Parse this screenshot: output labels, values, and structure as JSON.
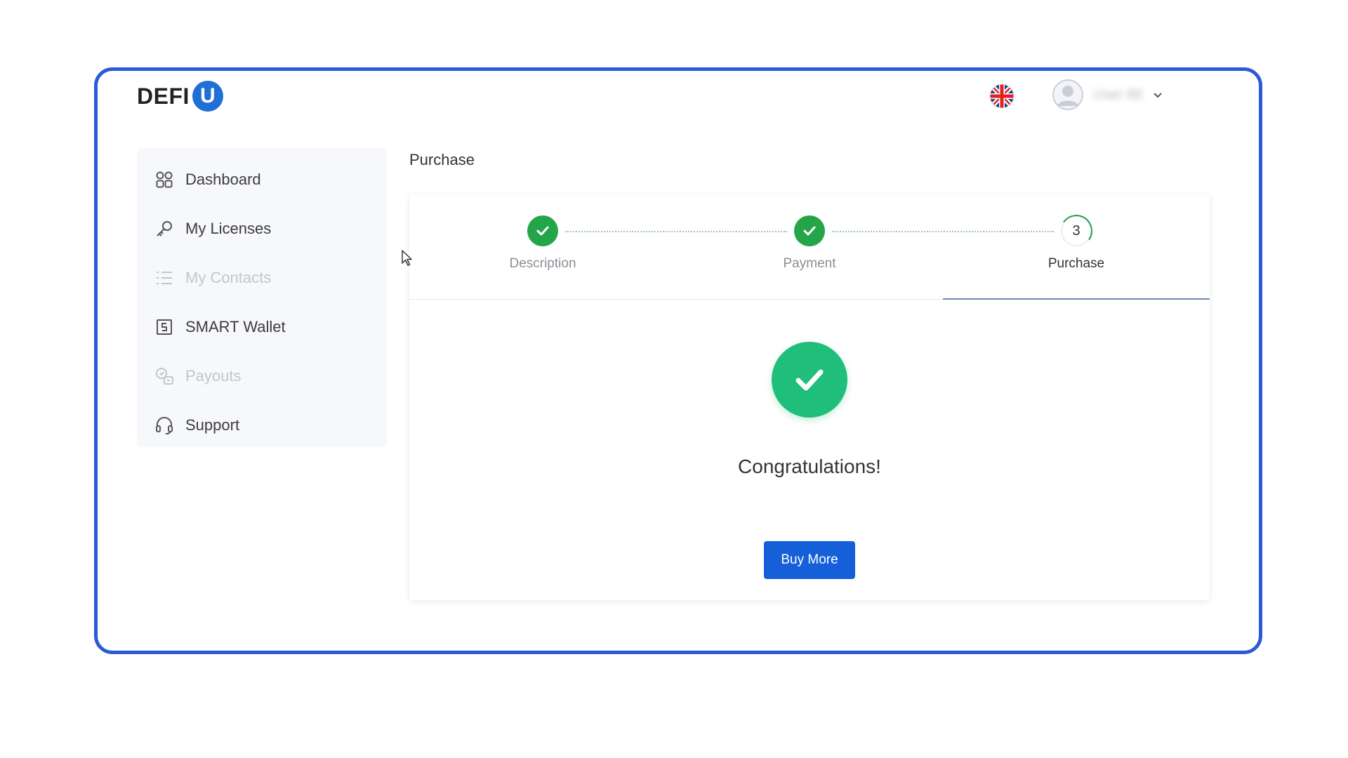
{
  "header": {
    "logo_text": "DEFI",
    "logo_badge": "U",
    "language_icon": "uk-flag-icon",
    "user_name": "User 88"
  },
  "sidebar": {
    "items": [
      {
        "label": "Dashboard",
        "icon": "dashboard-grid-icon",
        "enabled": true
      },
      {
        "label": "My Licenses",
        "icon": "key-icon",
        "enabled": true
      },
      {
        "label": "My Contacts",
        "icon": "list-icon",
        "enabled": false
      },
      {
        "label": "SMART Wallet",
        "icon": "wallet-icon",
        "enabled": true
      },
      {
        "label": "Payouts",
        "icon": "payouts-icon",
        "enabled": false
      },
      {
        "label": "Support",
        "icon": "headset-icon",
        "enabled": true
      }
    ]
  },
  "main": {
    "page_title": "Purchase",
    "stepper": {
      "steps": [
        {
          "label": "Description",
          "status": "complete"
        },
        {
          "label": "Payment",
          "status": "complete"
        },
        {
          "label": "Purchase",
          "status": "current",
          "number": "3"
        }
      ]
    },
    "success": {
      "message": "Congratulations!",
      "icon": "check-circle-icon"
    },
    "buy_more_label": "Buy More"
  },
  "colors": {
    "frame_border": "#2a5bd7",
    "step_complete": "#24a54a",
    "success": "#1fbe7a",
    "primary_button": "#1560d8"
  }
}
